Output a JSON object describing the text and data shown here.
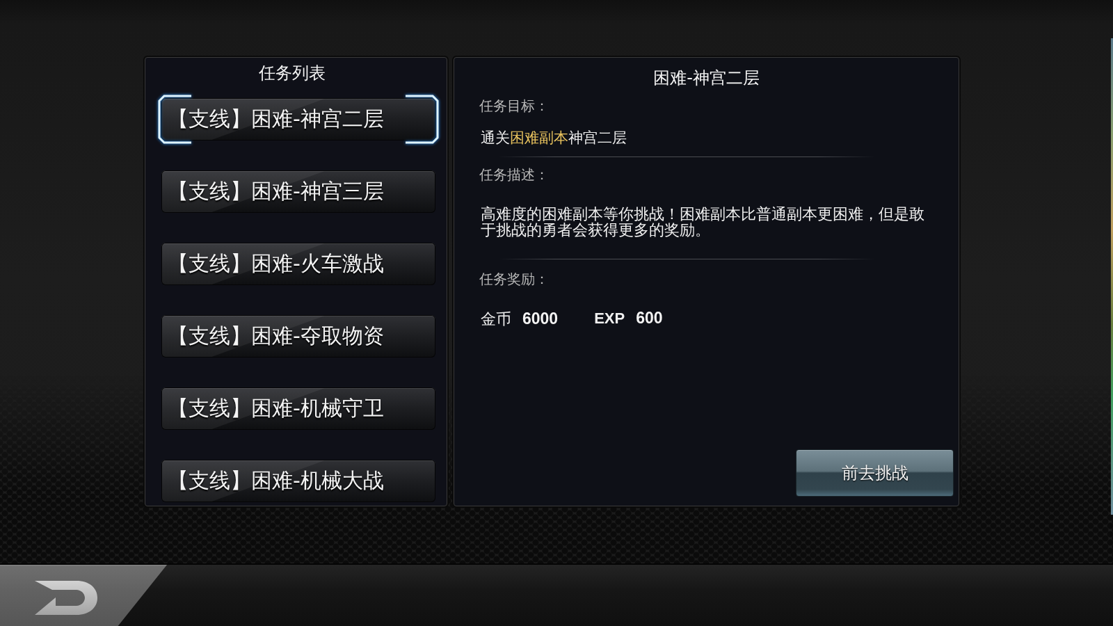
{
  "task_list": {
    "title": "任务列表",
    "items": [
      {
        "label": "【支线】困难-神宫二层",
        "selected": true
      },
      {
        "label": "【支线】困难-神宫三层",
        "selected": false
      },
      {
        "label": "【支线】困难-火车激战",
        "selected": false
      },
      {
        "label": "【支线】困难-夺取物资",
        "selected": false
      },
      {
        "label": "【支线】困难-机械守卫",
        "selected": false
      },
      {
        "label": "【支线】困难-机械大战",
        "selected": false
      }
    ]
  },
  "task_detail": {
    "title": "困难-神宫二层",
    "objective_label": "任务目标：",
    "objective": [
      {
        "text": "通关",
        "highlight": false
      },
      {
        "text": "困难副本",
        "highlight": true
      },
      {
        "text": "神宫二层",
        "highlight": false
      }
    ],
    "description_label": "任务描述：",
    "description": "高难度的困难副本等你挑战！困难副本比普通副本更困难，但是敢于挑战的勇者会获得更多的奖励。",
    "reward_label": "任务奖励：",
    "rewards": [
      {
        "name": "金币",
        "amount": "6000"
      },
      {
        "name": "EXP",
        "amount": "600"
      }
    ],
    "action_button": "前去挑战"
  }
}
